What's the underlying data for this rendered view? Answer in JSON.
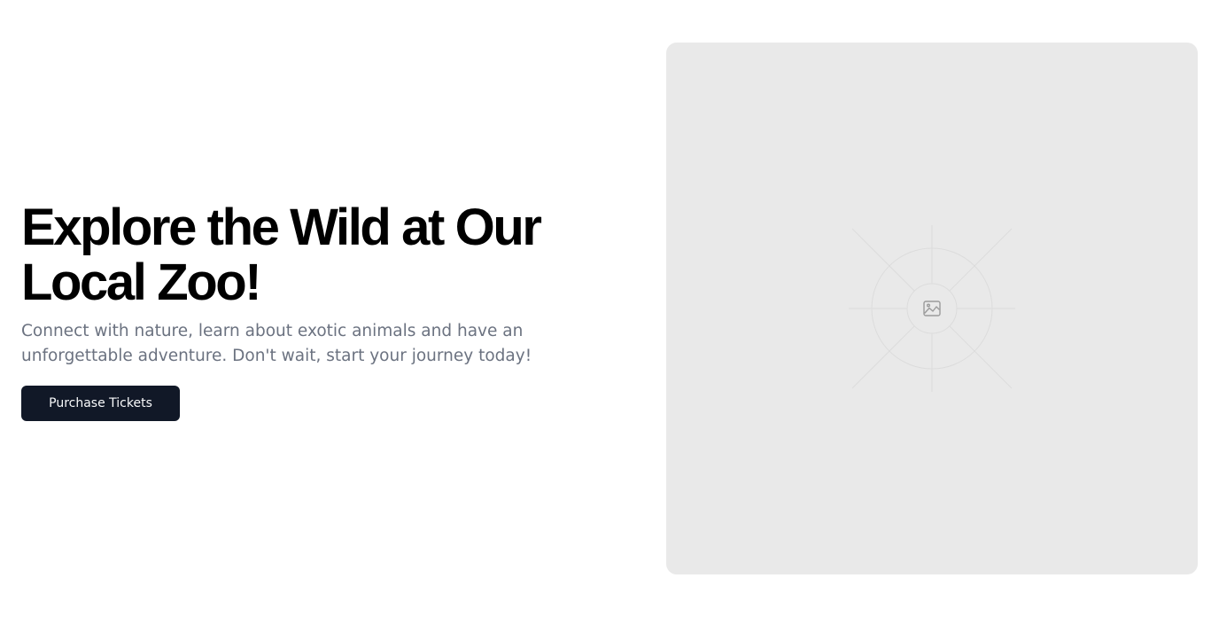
{
  "hero": {
    "headline": "Explore the Wild at Our Local Zoo!",
    "subtext": "Connect with nature, learn about exotic animals and have an unforgettable adventure. Don't wait, start your journey today!",
    "cta_label": "Purchase Tickets"
  },
  "media": {
    "icon": "image-placeholder-icon"
  },
  "colors": {
    "headline": "#000000",
    "subtext": "#6b7280",
    "button_bg": "#111827",
    "button_text": "#f9fafb",
    "media_bg": "#e9e9e9"
  }
}
